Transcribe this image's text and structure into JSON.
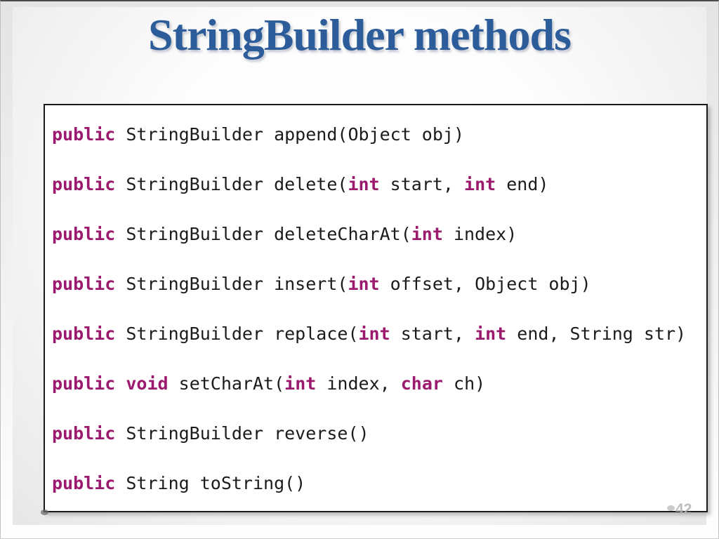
{
  "slide": {
    "title": "StringBuilder methods",
    "page_number": "42",
    "title_color": "#2c5c99",
    "keyword_color": "#9c1a6e",
    "code_text_color": "#1b1b1b",
    "code_box_border_color": "#1a1a1a",
    "code_box_background": "#ffffff"
  },
  "code": {
    "language": "java",
    "lines": [
      {
        "index": 0,
        "text": "public StringBuilder append(Object obj)",
        "tokens": [
          {
            "t": "public",
            "kw": true
          },
          {
            "t": " StringBuilder append(Object obj)",
            "kw": false
          }
        ]
      },
      {
        "index": 1,
        "text": "public StringBuilder delete(int start, int end)",
        "tokens": [
          {
            "t": "public",
            "kw": true
          },
          {
            "t": " StringBuilder delete(",
            "kw": false
          },
          {
            "t": "int",
            "kw": true
          },
          {
            "t": " start, ",
            "kw": false
          },
          {
            "t": "int",
            "kw": true
          },
          {
            "t": " end)",
            "kw": false
          }
        ]
      },
      {
        "index": 2,
        "text": "public StringBuilder deleteCharAt(int index)",
        "tokens": [
          {
            "t": "public",
            "kw": true
          },
          {
            "t": " StringBuilder deleteCharAt(",
            "kw": false
          },
          {
            "t": "int",
            "kw": true
          },
          {
            "t": " index)",
            "kw": false
          }
        ]
      },
      {
        "index": 3,
        "text": "public StringBuilder insert(int offset, Object obj)",
        "tokens": [
          {
            "t": "public",
            "kw": true
          },
          {
            "t": " StringBuilder insert(",
            "kw": false
          },
          {
            "t": "int",
            "kw": true
          },
          {
            "t": " offset, Object obj)",
            "kw": false
          }
        ]
      },
      {
        "index": 4,
        "text": "public StringBuilder replace(int start, int end, String str)",
        "tokens": [
          {
            "t": "public",
            "kw": true
          },
          {
            "t": " StringBuilder replace(",
            "kw": false
          },
          {
            "t": "int",
            "kw": true
          },
          {
            "t": " start, ",
            "kw": false
          },
          {
            "t": "int",
            "kw": true
          },
          {
            "t": " end, String str)",
            "kw": false
          }
        ]
      },
      {
        "index": 5,
        "text": "public void setCharAt(int index, char ch)",
        "tokens": [
          {
            "t": "public",
            "kw": true
          },
          {
            "t": " ",
            "kw": false
          },
          {
            "t": "void",
            "kw": true
          },
          {
            "t": " setCharAt(",
            "kw": false
          },
          {
            "t": "int",
            "kw": true
          },
          {
            "t": " index, ",
            "kw": false
          },
          {
            "t": "char",
            "kw": true
          },
          {
            "t": " ch)",
            "kw": false
          }
        ]
      },
      {
        "index": 6,
        "text": "public StringBuilder reverse()",
        "tokens": [
          {
            "t": "public",
            "kw": true
          },
          {
            "t": " StringBuilder reverse()",
            "kw": false
          }
        ]
      },
      {
        "index": 7,
        "text": "public String toString()",
        "tokens": [
          {
            "t": "public",
            "kw": true
          },
          {
            "t": " String toString()",
            "kw": false
          }
        ]
      }
    ]
  }
}
